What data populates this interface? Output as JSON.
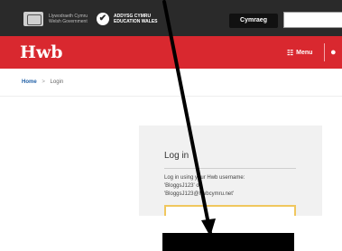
{
  "topbar": {
    "gov_logo_text": "Llywodraeth Cymru\nWelsh Government",
    "edu_logo_text": "ADDYSG CYMRU\nEDUCATION WALES",
    "language_button": "Cymraeg",
    "search_placeholder": ""
  },
  "header": {
    "logo": "Hwb",
    "menu_label": "Menu",
    "menu_icon": "grid-icon",
    "user_icon": "user-icon",
    "brand_color": "#d9282f"
  },
  "breadcrumb": {
    "home": "Home",
    "separator": ">",
    "current": "Login"
  },
  "login": {
    "title": "Log in",
    "help_text": "Log in using your Hwb username:\n'BloggsJ123' or\n'BloggsJ123@hwbcymru.net'",
    "username_value": ""
  },
  "colors": {
    "topbar": "#2a2a2a",
    "accent": "#d9282f",
    "input_border": "#f0c75e"
  }
}
